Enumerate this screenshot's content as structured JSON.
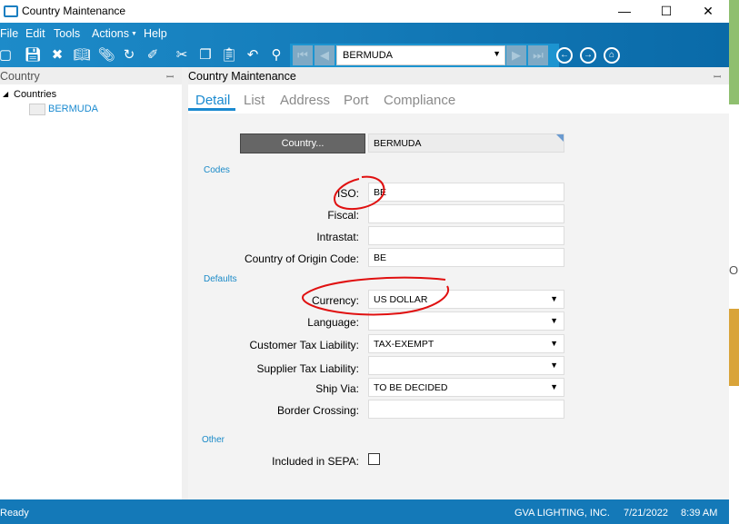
{
  "window": {
    "title": "Country Maintenance",
    "minimize": "—",
    "maximize": "☐",
    "close": "✕"
  },
  "menu": [
    "File",
    "Edit",
    "Tools",
    "Actions",
    "Help"
  ],
  "toolbar": {
    "record": "BERMUDA"
  },
  "left_panel": {
    "title": "Country",
    "tree_root": "Countries",
    "tree_item": "BERMUDA"
  },
  "main": {
    "title": "Country Maintenance",
    "tabs": [
      "Detail",
      "List",
      "Address",
      "Port",
      "Compliance"
    ],
    "active_tab": "Detail"
  },
  "form": {
    "country_button": "Country...",
    "country_value": "BERMUDA",
    "codes_section": "Codes",
    "iso_label": "ISO:",
    "iso_value": "BE",
    "fiscal_label": "Fiscal:",
    "fiscal_value": "",
    "intrastat_label": "Intrastat:",
    "intrastat_value": "",
    "origin_label": "Country of Origin Code:",
    "origin_value": "BE",
    "defaults_section": "Defaults",
    "currency_label": "Currency:",
    "currency_value": "US DOLLAR",
    "language_label": "Language:",
    "language_value": "",
    "cust_tax_label": "Customer Tax Liability:",
    "cust_tax_value": "TAX-EXEMPT",
    "supp_tax_label": "Supplier Tax Liability:",
    "supp_tax_value": "",
    "ship_via_label": "Ship Via:",
    "ship_via_value": "TO BE DECIDED",
    "border_label": "Border  Crossing:",
    "border_value": "",
    "other_section": "Other",
    "sepa_label": "Included in SEPA:",
    "sepa_checked": false
  },
  "status": {
    "text": "Ready",
    "company": "GVA LIGHTING, INC.",
    "date": "7/21/2022",
    "time": "8:39 AM"
  },
  "desktop": {
    "partial_text": "Op"
  },
  "colors": {
    "accent": "#1479b8",
    "annotation": "#e01010",
    "section": "#1a8ac8"
  }
}
